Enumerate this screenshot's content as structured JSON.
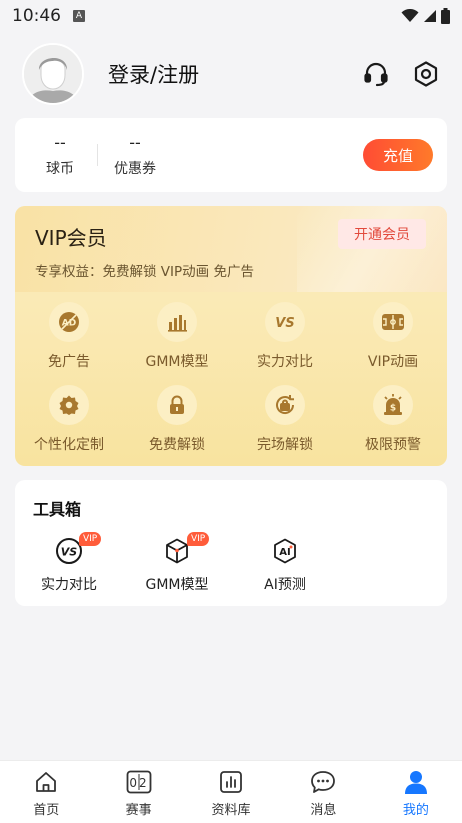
{
  "status_bar": {
    "time": "10:46",
    "notification_letter": "A",
    "icons": [
      "wifi-icon",
      "signal-icon",
      "battery-icon"
    ]
  },
  "profile": {
    "login_text": "登录/注册",
    "icons": [
      "headset-icon",
      "settings-icon"
    ]
  },
  "wallet": {
    "coins_value": "--",
    "coins_label": "球币",
    "coupon_value": "--",
    "coupon_label": "优惠券",
    "recharge_label": "充值"
  },
  "vip": {
    "title": "VIP会员",
    "subtitle": "专享权益：免费解锁 VIP动画 免广告",
    "open_label": "开通会员",
    "perks": [
      {
        "label": "免广告",
        "icon": "no-ad-icon"
      },
      {
        "label": "GMM模型",
        "icon": "chart-icon"
      },
      {
        "label": "实力对比",
        "icon": "vs-icon"
      },
      {
        "label": "VIP动画",
        "icon": "field-icon"
      },
      {
        "label": "个性化定制",
        "icon": "gear-icon"
      },
      {
        "label": "免费解锁",
        "icon": "lock-icon"
      },
      {
        "label": "完场解锁",
        "icon": "unlock-rotate-icon"
      },
      {
        "label": "极限预警",
        "icon": "alarm-icon"
      }
    ]
  },
  "toolbox": {
    "title": "工具箱",
    "tools": [
      {
        "label": "实力对比",
        "badge": "VIP",
        "icon": "vs-icon"
      },
      {
        "label": "GMM模型",
        "badge": "VIP",
        "icon": "cube-icon"
      },
      {
        "label": "AI预测",
        "badge": "",
        "icon": "ai-icon"
      }
    ]
  },
  "tabbar": {
    "tabs": [
      {
        "label": "首页",
        "icon": "home-icon",
        "digits": ""
      },
      {
        "label": "赛事",
        "icon": "score-icon",
        "digits": "02"
      },
      {
        "label": "资料库",
        "icon": "database-icon",
        "digits": ""
      },
      {
        "label": "消息",
        "icon": "message-icon",
        "digits": ""
      },
      {
        "label": "我的",
        "icon": "user-icon",
        "digits": ""
      }
    ],
    "active_index": 4
  },
  "colors": {
    "accent": "#1677ff",
    "recharge": "#ff5a30",
    "vip_text": "#7a5a2c",
    "vip_icon": "#a8782e"
  }
}
